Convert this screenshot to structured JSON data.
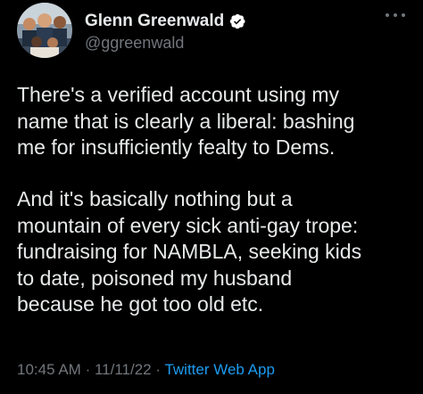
{
  "author": {
    "display_name": "Glenn Greenwald",
    "handle": "@ggreenwald"
  },
  "tweet": {
    "paragraphs": [
      "There's a verified account using my\nname that is clearly a liberal: bashing\nme for insufficiently fealty to Dems.",
      "And it's basically nothing but a\nmountain of every sick anti-gay trope:\nfundraising for NAMBLA, seeking kids\nto date, poisoned my husband\nbecause he got too old etc."
    ],
    "time": "10:45 AM",
    "separator": "·",
    "date": "11/11/22",
    "source": "Twitter Web App"
  },
  "icons": {
    "verified": "verified-badge-icon",
    "more": "more-options-icon"
  },
  "colors": {
    "background": "#000000",
    "text_primary": "#e7e9ea",
    "text_secondary": "#71767b",
    "accent": "#1d9bf0"
  }
}
